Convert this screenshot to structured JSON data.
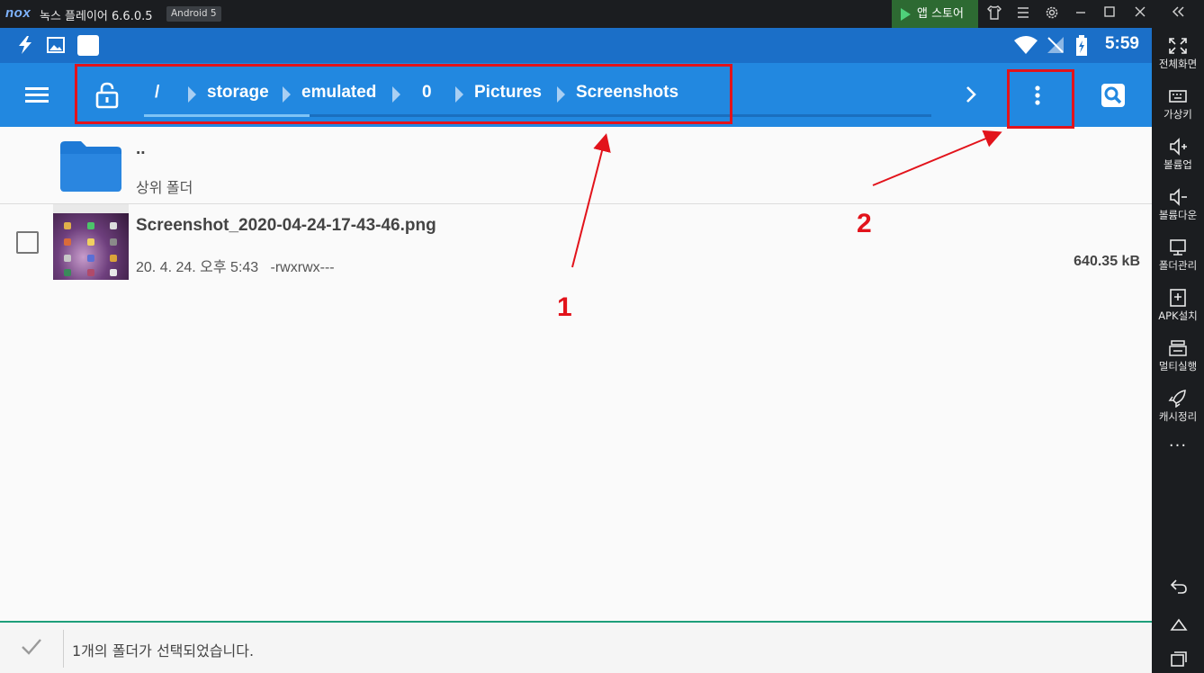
{
  "titlebar": {
    "logo": "nox",
    "title": "녹스 플레이어 6.6.0.5",
    "android_badge": "Android 5",
    "app_store_label": "앱 스토어",
    "icons": [
      "shirt-icon",
      "menu-icon",
      "gear-icon",
      "minimize-icon",
      "maximize-icon",
      "close-icon",
      "collapse-sidebar-icon"
    ]
  },
  "statusbar": {
    "time": "5:59",
    "icons": [
      "flash-icon",
      "image-icon",
      "white-square-icon",
      "wifi-icon",
      "no-signal-icon",
      "battery-icon"
    ]
  },
  "toolbar": {
    "path": [
      "/",
      "storage",
      "emulated",
      "0",
      "Pictures",
      "Screenshots"
    ],
    "progress_fraction": 0.21,
    "icons": [
      "menu-icon",
      "unlock-icon",
      "chevron-right-icon",
      "more-vert-icon",
      "search-icon"
    ]
  },
  "annotations": {
    "one": "1",
    "two": "2",
    "color": "#e2131b"
  },
  "list": {
    "parent": {
      "name": "..",
      "label": "상위 폴더"
    },
    "file": {
      "name": "Screenshot_2020-04-24-17-43-46.png",
      "meta": "20. 4. 24. 오후 5:43   -rwxrwx---",
      "size": "640.35 kB"
    }
  },
  "bottombar": {
    "message": "1개의 폴더가 선택되었습니다."
  },
  "sidebar": {
    "items": [
      {
        "label": "전체화면",
        "icon": "fullscreen-icon"
      },
      {
        "label": "가상키",
        "icon": "keyboard-icon"
      },
      {
        "label": "볼륨업",
        "icon": "volume-up-icon"
      },
      {
        "label": "볼륨다운",
        "icon": "volume-down-icon"
      },
      {
        "label": "폴더관리",
        "icon": "folder-manage-icon"
      },
      {
        "label": "APK설치",
        "icon": "apk-install-icon"
      },
      {
        "label": "멀티실행",
        "icon": "multi-instance-icon"
      },
      {
        "label": "캐시정리",
        "icon": "rocket-icon"
      }
    ],
    "more": "···",
    "nav_icons": [
      "back-icon",
      "home-icon",
      "recents-icon"
    ]
  },
  "colors": {
    "toolbar": "#2288e0",
    "statusbar": "#1b6fc8",
    "accent_green": "#1e9e7a",
    "folder": "#1e7ad6"
  }
}
